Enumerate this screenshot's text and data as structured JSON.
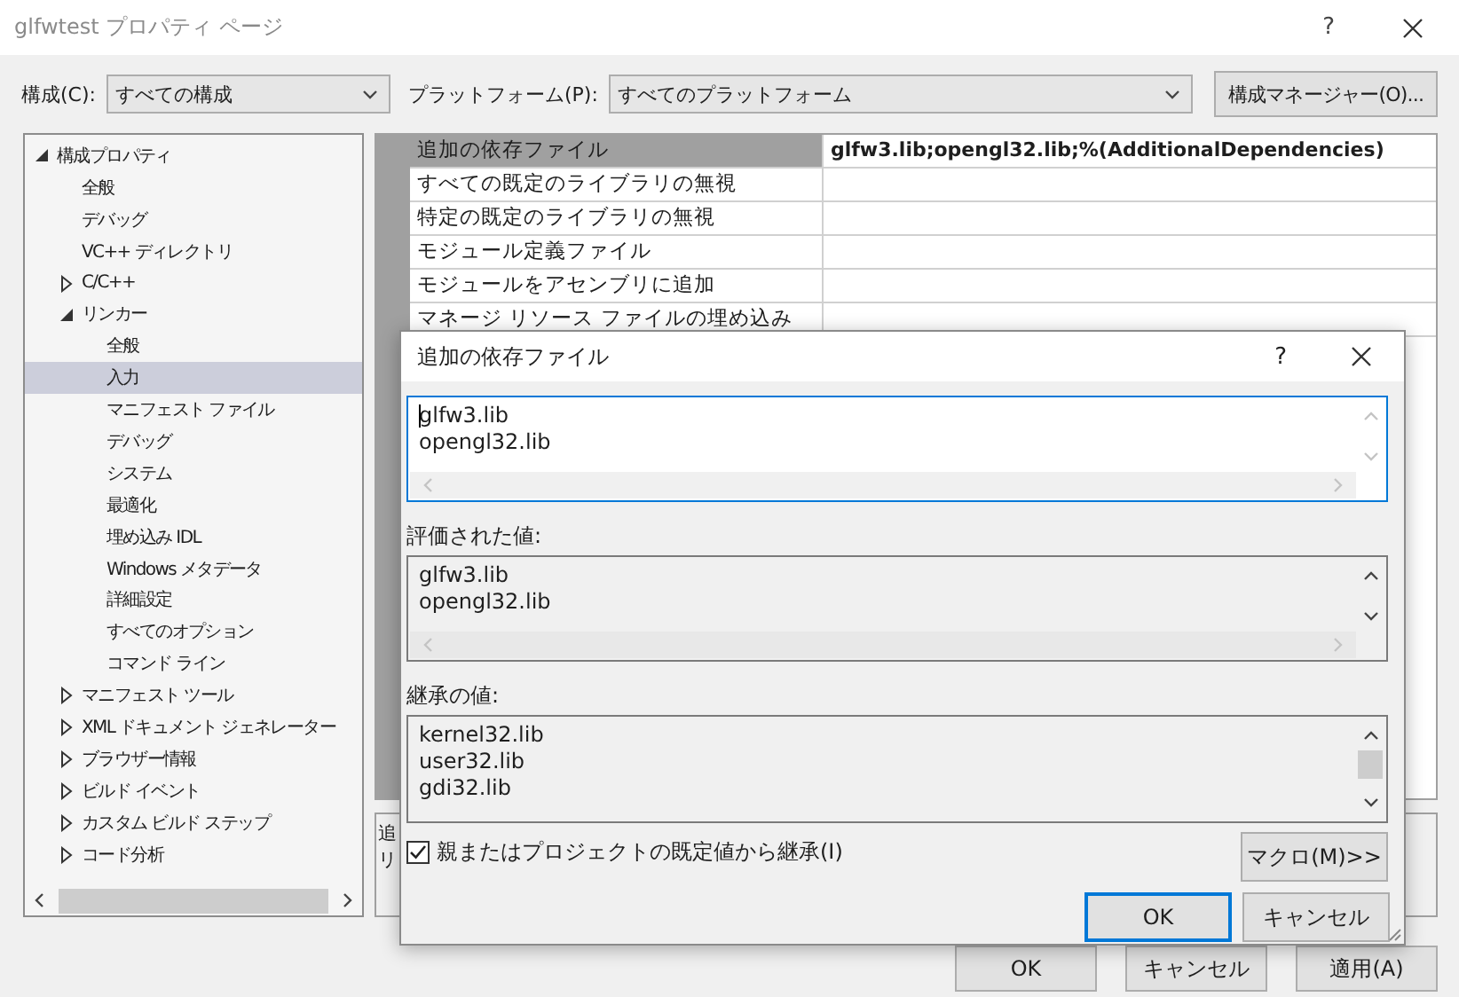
{
  "window": {
    "title": "glfwtest プロパティ ページ",
    "help": "?"
  },
  "toolbar": {
    "config_label": "構成(C):",
    "config_value": "すべての構成",
    "platform_label": "プラットフォーム(P):",
    "platform_value": "すべてのプラットフォーム",
    "manager_button": "構成マネージャー(O)..."
  },
  "tree": [
    {
      "label": "構成プロパティ",
      "kind": "group",
      "expanded": true,
      "selected": false,
      "children": [
        {
          "label": "全般",
          "kind": "leaf",
          "selected": false
        },
        {
          "label": "デバッグ",
          "kind": "leaf",
          "selected": false
        },
        {
          "label": "VC++ ディレクトリ",
          "kind": "leaf",
          "selected": false
        },
        {
          "label": "C/C++",
          "kind": "group",
          "expanded": false,
          "selected": false
        },
        {
          "label": "リンカー",
          "kind": "group",
          "expanded": true,
          "selected": false,
          "children": [
            {
              "label": "全般",
              "kind": "leaf",
              "selected": false
            },
            {
              "label": "入力",
              "kind": "leaf",
              "selected": true
            },
            {
              "label": "マニフェスト ファイル",
              "kind": "leaf",
              "selected": false
            },
            {
              "label": "デバッグ",
              "kind": "leaf",
              "selected": false
            },
            {
              "label": "システム",
              "kind": "leaf",
              "selected": false
            },
            {
              "label": "最適化",
              "kind": "leaf",
              "selected": false
            },
            {
              "label": "埋め込み IDL",
              "kind": "leaf",
              "selected": false
            },
            {
              "label": "Windows メタデータ",
              "kind": "leaf",
              "selected": false
            },
            {
              "label": "詳細設定",
              "kind": "leaf",
              "selected": false
            },
            {
              "label": "すべてのオプション",
              "kind": "leaf",
              "selected": false
            },
            {
              "label": "コマンド ライン",
              "kind": "leaf",
              "selected": false
            }
          ]
        },
        {
          "label": "マニフェスト ツール",
          "kind": "group",
          "expanded": false,
          "selected": false
        },
        {
          "label": "XML ドキュメント ジェネレーター",
          "kind": "group",
          "expanded": false,
          "selected": false
        },
        {
          "label": "ブラウザー情報",
          "kind": "group",
          "expanded": false,
          "selected": false
        },
        {
          "label": "ビルド イベント",
          "kind": "group",
          "expanded": false,
          "selected": false
        },
        {
          "label": "カスタム ビルド ステップ",
          "kind": "group",
          "expanded": false,
          "selected": false
        },
        {
          "label": "コード分析",
          "kind": "group",
          "expanded": false,
          "selected": false
        }
      ]
    }
  ],
  "grid": {
    "rows": [
      {
        "name": "追加の依存ファイル",
        "value": "glfw3.lib;opengl32.lib;%(AdditionalDependencies)",
        "selected": true
      },
      {
        "name": "すべての既定のライブラリの無視",
        "selected": false
      },
      {
        "name": "特定の既定のライブラリの無視",
        "selected": false
      },
      {
        "name": "モジュール定義ファイル",
        "selected": false
      },
      {
        "name": "モジュールをアセンブリに追加",
        "selected": false
      },
      {
        "name": "マネージ リソース ファイルの埋め込み",
        "selected": false
      }
    ]
  },
  "description": {
    "lines": [
      "追",
      "リ"
    ]
  },
  "buttons": [
    "OK",
    "キャンセル",
    "適用(A)"
  ],
  "dialog": {
    "title": "追加の依存ファイル",
    "help": "?",
    "edit_lines": [
      "glfw3.lib",
      "opengl32.lib"
    ],
    "evaluated_label": "評価された値:",
    "evaluated_lines": [
      "glfw3.lib",
      "opengl32.lib"
    ],
    "inherited_label": "継承の値:",
    "inherited_lines": [
      "kernel32.lib",
      "user32.lib",
      "gdi32.lib"
    ],
    "inherit_checkbox": {
      "label": "親またはプロジェクトの既定値から継承(I)",
      "checked": true
    },
    "macro_button": "マクロ(M)>>",
    "ok_button": "OK",
    "cancel_button": "キャンセル"
  }
}
